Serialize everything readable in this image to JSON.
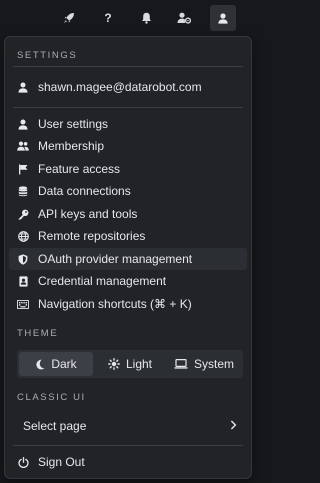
{
  "topbar": {
    "buttons": [
      {
        "icon": "rocket-icon"
      },
      {
        "icon": "help-icon",
        "glyph": "?"
      },
      {
        "icon": "bell-icon"
      },
      {
        "icon": "user-settings-icon"
      },
      {
        "icon": "user-icon"
      }
    ]
  },
  "menu": {
    "settings_label": "SETTINGS",
    "account_email": "shawn.magee@datarobot.com",
    "items": [
      {
        "label": "User settings",
        "icon": "user-icon"
      },
      {
        "label": "Membership",
        "icon": "users-icon"
      },
      {
        "label": "Feature access",
        "icon": "flag-icon"
      },
      {
        "label": "Data connections",
        "icon": "database-icon"
      },
      {
        "label": "API keys and tools",
        "icon": "key-icon"
      },
      {
        "label": "Remote repositories",
        "icon": "globe-icon"
      },
      {
        "label": "OAuth provider management",
        "icon": "shield-icon"
      },
      {
        "label": "Credential management",
        "icon": "id-badge-icon"
      },
      {
        "label": "Navigation shortcuts (⌘ + K)",
        "icon": "keyboard-icon"
      }
    ],
    "theme_label": "THEME",
    "theme_options": [
      {
        "label": "Dark",
        "icon": "moon-icon",
        "selected": true
      },
      {
        "label": "Light",
        "icon": "sun-icon",
        "selected": false
      },
      {
        "label": "System",
        "icon": "laptop-icon",
        "selected": false
      }
    ],
    "classic_label": "CLASSIC UI",
    "select_page": "Select page",
    "sign_out": "Sign Out"
  }
}
